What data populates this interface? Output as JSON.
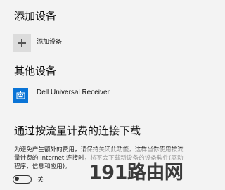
{
  "sections": {
    "add_device": {
      "title": "添加设备",
      "button_label": "添加设备"
    },
    "other_devices": {
      "title": "其他设备",
      "devices": [
        {
          "name": "Dell Universal Receiver",
          "icon": "keyboard-icon"
        }
      ]
    },
    "metered_download": {
      "title": "通过按流量计费的连接下载",
      "description_lines": [
        "为避免产生额外的费用，请保持关闭此功能，这样当你使用按流",
        "量计费的 Internet 连接时，将不会下载新设备的设备软件(驱动",
        "程序、信息和应用)。"
      ],
      "toggle_state_label": "关",
      "toggle_on": false
    }
  },
  "watermark": "191路由网",
  "colors": {
    "background": "#f3f3f3",
    "device_icon": "#0a74d6",
    "plus_tile": "#dcdcdc"
  }
}
